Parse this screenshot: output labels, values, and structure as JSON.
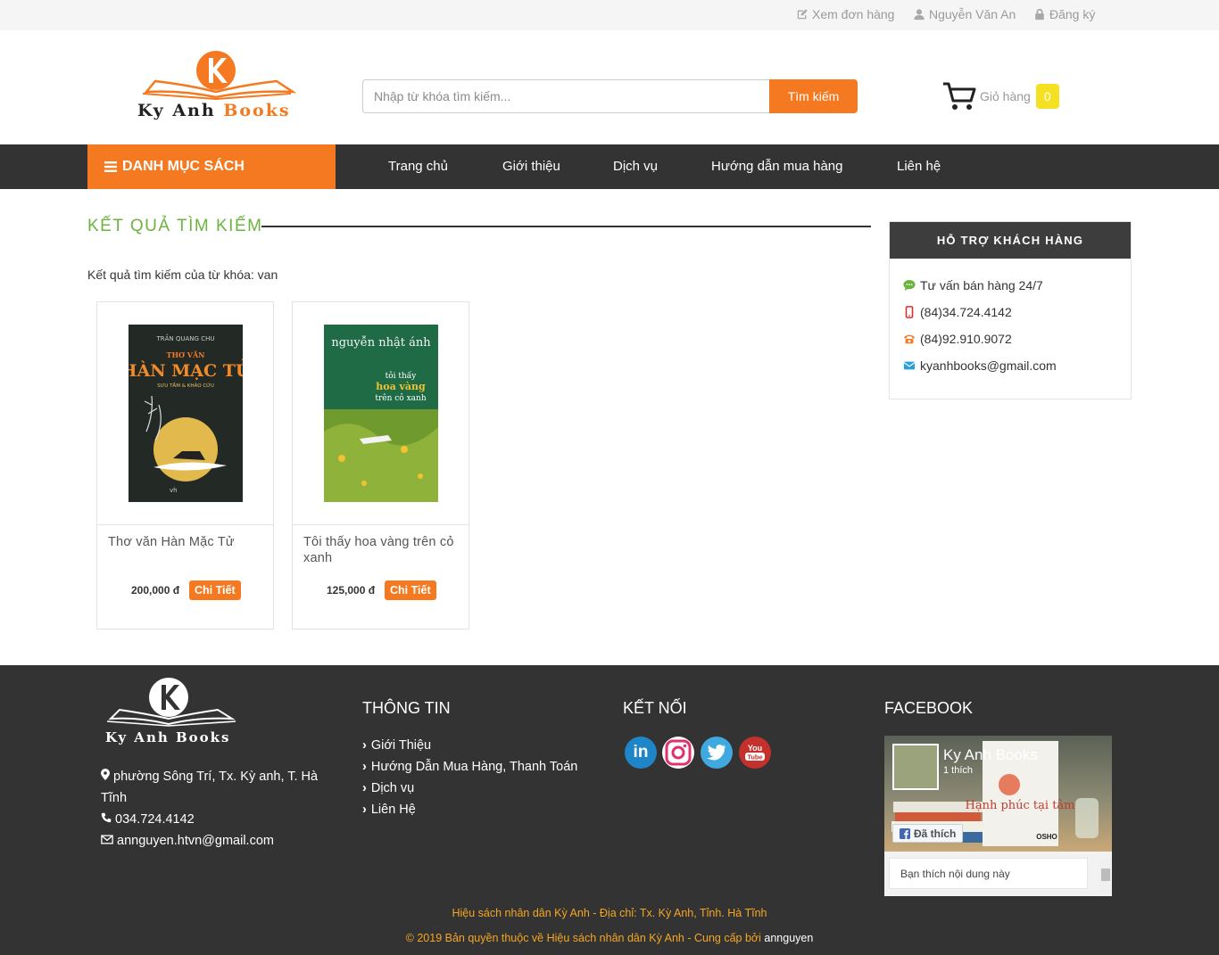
{
  "topbar": {
    "orders": "Xem đơn hàng",
    "user": "Nguyễn Văn An",
    "register": "Đăng ký"
  },
  "header": {
    "logo_text_1": "Ky Anh",
    "logo_text_2": "Books",
    "search_placeholder": "Nhập từ khóa tìm kiếm...",
    "search_button": "Tìm kiếm",
    "cart_label": "Giỏ hàng",
    "cart_count": "0"
  },
  "nav": {
    "category": "DANH MỤC SÁCH",
    "items": [
      "Trang chủ",
      "Giới thiệu",
      "Dịch vụ",
      "Hướng dẫn mua hàng",
      "Liên hệ"
    ]
  },
  "main": {
    "title": "KẾT QUẢ TÌM KIẾM",
    "keyword_text": "Kết quả tìm kiếm của từ khóa: van",
    "products": [
      {
        "name": "Thơ văn Hàn Mặc Tử",
        "price": "200,000 đ",
        "button": "Chi Tiết",
        "cover": {
          "author": "TRẦN QUANG CHU",
          "pre": "THƠ VĂN",
          "title": "HÀN MẠC TỬ",
          "sub": "SƯU TẦM & KHẢO CỨU",
          "publisher": "vh"
        }
      },
      {
        "name": "Tôi thấy hoa vàng trên cỏ xanh",
        "price": "125,000 đ",
        "button": "Chi Tiết",
        "cover": {
          "author": "nguyễn nhật ánh",
          "t1": "tôi thấy",
          "t2": "hoa vàng",
          "t3": "trên cỏ xanh"
        }
      }
    ]
  },
  "support": {
    "title": "HỖ TRỢ KHÁCH HÀNG",
    "items": [
      "Tư vấn bán hàng 24/7",
      "(84)34.724.4142",
      "(84)92.910.9072",
      "kyanhbooks@gmail.com"
    ]
  },
  "footer": {
    "logo_text": "Ky Anh Books",
    "address": "phường Sông Trí, Tx. Kỳ anh, T. Hà Tĩnh",
    "phone": "034.724.4142",
    "email": "annguyen.htvn@gmail.com",
    "info_title": "THÔNG TIN",
    "info_links": [
      "Giới Thiệu",
      "Hướng Dẫn Mua Hàng, Thanh Toán",
      "Dịch vụ",
      "Liên Hệ"
    ],
    "connect_title": "KẾT NỐI",
    "facebook_title": "FACEBOOK",
    "fb_page_name": "Ky Anh Books",
    "fb_likes": "1 thích",
    "fb_liked": "Đã thích",
    "fb_book_title": "Hạnh phúc tại tâm",
    "fb_book_author": "OSHO",
    "fb_comment": "Bạn thích nội dung này",
    "copyright_1": "Hiệu sách nhân dân Kỳ Anh - Địa chỉ: Tx. Kỳ Anh, Tỉnh. Hà Tĩnh",
    "copyright_2": "© 2019 Bản quyền thuộc về Hiệu sách nhân dân Kỳ Anh - Cung cấp bởi",
    "copyright_author": "annguyen"
  },
  "colors": {
    "accent": "#f47920",
    "green": "#6db33f",
    "dark": "#333333",
    "badge": "#f5e022",
    "copyright": "#f5a623"
  }
}
